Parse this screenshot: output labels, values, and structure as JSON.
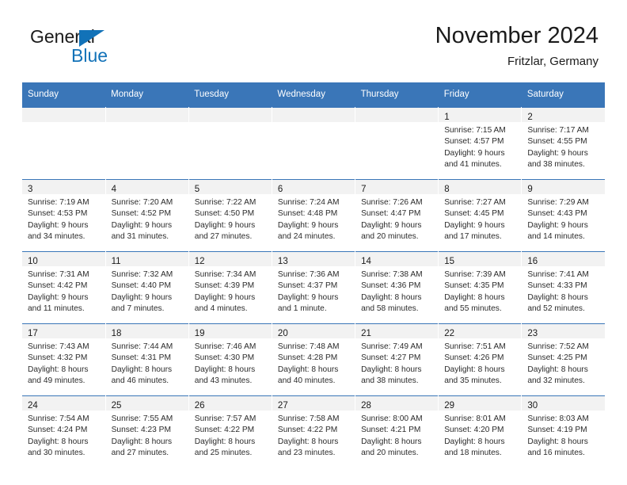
{
  "brand": {
    "name_part1": "General",
    "name_part2": "Blue",
    "triangle_icon": "triangle-icon",
    "colors": {
      "dark": "#1b1b1b",
      "blue": "#1272b8"
    }
  },
  "header": {
    "title": "November 2024",
    "subtitle": "Fritzlar, Germany"
  },
  "theme": {
    "header_blue": "#3a76b8",
    "daynum_band": "#f2f2f2",
    "cell_background": "#ffffff",
    "text": "#2b2b2b"
  },
  "weekday_headers": [
    "Sunday",
    "Monday",
    "Tuesday",
    "Wednesday",
    "Thursday",
    "Friday",
    "Saturday"
  ],
  "weeks": [
    [
      {
        "day": "",
        "sunrise": "",
        "sunset": "",
        "daylight_line1": "",
        "daylight_line2": ""
      },
      {
        "day": "",
        "sunrise": "",
        "sunset": "",
        "daylight_line1": "",
        "daylight_line2": ""
      },
      {
        "day": "",
        "sunrise": "",
        "sunset": "",
        "daylight_line1": "",
        "daylight_line2": ""
      },
      {
        "day": "",
        "sunrise": "",
        "sunset": "",
        "daylight_line1": "",
        "daylight_line2": ""
      },
      {
        "day": "",
        "sunrise": "",
        "sunset": "",
        "daylight_line1": "",
        "daylight_line2": ""
      },
      {
        "day": "1",
        "sunrise": "Sunrise: 7:15 AM",
        "sunset": "Sunset: 4:57 PM",
        "daylight_line1": "Daylight: 9 hours",
        "daylight_line2": "and 41 minutes."
      },
      {
        "day": "2",
        "sunrise": "Sunrise: 7:17 AM",
        "sunset": "Sunset: 4:55 PM",
        "daylight_line1": "Daylight: 9 hours",
        "daylight_line2": "and 38 minutes."
      }
    ],
    [
      {
        "day": "3",
        "sunrise": "Sunrise: 7:19 AM",
        "sunset": "Sunset: 4:53 PM",
        "daylight_line1": "Daylight: 9 hours",
        "daylight_line2": "and 34 minutes."
      },
      {
        "day": "4",
        "sunrise": "Sunrise: 7:20 AM",
        "sunset": "Sunset: 4:52 PM",
        "daylight_line1": "Daylight: 9 hours",
        "daylight_line2": "and 31 minutes."
      },
      {
        "day": "5",
        "sunrise": "Sunrise: 7:22 AM",
        "sunset": "Sunset: 4:50 PM",
        "daylight_line1": "Daylight: 9 hours",
        "daylight_line2": "and 27 minutes."
      },
      {
        "day": "6",
        "sunrise": "Sunrise: 7:24 AM",
        "sunset": "Sunset: 4:48 PM",
        "daylight_line1": "Daylight: 9 hours",
        "daylight_line2": "and 24 minutes."
      },
      {
        "day": "7",
        "sunrise": "Sunrise: 7:26 AM",
        "sunset": "Sunset: 4:47 PM",
        "daylight_line1": "Daylight: 9 hours",
        "daylight_line2": "and 20 minutes."
      },
      {
        "day": "8",
        "sunrise": "Sunrise: 7:27 AM",
        "sunset": "Sunset: 4:45 PM",
        "daylight_line1": "Daylight: 9 hours",
        "daylight_line2": "and 17 minutes."
      },
      {
        "day": "9",
        "sunrise": "Sunrise: 7:29 AM",
        "sunset": "Sunset: 4:43 PM",
        "daylight_line1": "Daylight: 9 hours",
        "daylight_line2": "and 14 minutes."
      }
    ],
    [
      {
        "day": "10",
        "sunrise": "Sunrise: 7:31 AM",
        "sunset": "Sunset: 4:42 PM",
        "daylight_line1": "Daylight: 9 hours",
        "daylight_line2": "and 11 minutes."
      },
      {
        "day": "11",
        "sunrise": "Sunrise: 7:32 AM",
        "sunset": "Sunset: 4:40 PM",
        "daylight_line1": "Daylight: 9 hours",
        "daylight_line2": "and 7 minutes."
      },
      {
        "day": "12",
        "sunrise": "Sunrise: 7:34 AM",
        "sunset": "Sunset: 4:39 PM",
        "daylight_line1": "Daylight: 9 hours",
        "daylight_line2": "and 4 minutes."
      },
      {
        "day": "13",
        "sunrise": "Sunrise: 7:36 AM",
        "sunset": "Sunset: 4:37 PM",
        "daylight_line1": "Daylight: 9 hours",
        "daylight_line2": "and 1 minute."
      },
      {
        "day": "14",
        "sunrise": "Sunrise: 7:38 AM",
        "sunset": "Sunset: 4:36 PM",
        "daylight_line1": "Daylight: 8 hours",
        "daylight_line2": "and 58 minutes."
      },
      {
        "day": "15",
        "sunrise": "Sunrise: 7:39 AM",
        "sunset": "Sunset: 4:35 PM",
        "daylight_line1": "Daylight: 8 hours",
        "daylight_line2": "and 55 minutes."
      },
      {
        "day": "16",
        "sunrise": "Sunrise: 7:41 AM",
        "sunset": "Sunset: 4:33 PM",
        "daylight_line1": "Daylight: 8 hours",
        "daylight_line2": "and 52 minutes."
      }
    ],
    [
      {
        "day": "17",
        "sunrise": "Sunrise: 7:43 AM",
        "sunset": "Sunset: 4:32 PM",
        "daylight_line1": "Daylight: 8 hours",
        "daylight_line2": "and 49 minutes."
      },
      {
        "day": "18",
        "sunrise": "Sunrise: 7:44 AM",
        "sunset": "Sunset: 4:31 PM",
        "daylight_line1": "Daylight: 8 hours",
        "daylight_line2": "and 46 minutes."
      },
      {
        "day": "19",
        "sunrise": "Sunrise: 7:46 AM",
        "sunset": "Sunset: 4:30 PM",
        "daylight_line1": "Daylight: 8 hours",
        "daylight_line2": "and 43 minutes."
      },
      {
        "day": "20",
        "sunrise": "Sunrise: 7:48 AM",
        "sunset": "Sunset: 4:28 PM",
        "daylight_line1": "Daylight: 8 hours",
        "daylight_line2": "and 40 minutes."
      },
      {
        "day": "21",
        "sunrise": "Sunrise: 7:49 AM",
        "sunset": "Sunset: 4:27 PM",
        "daylight_line1": "Daylight: 8 hours",
        "daylight_line2": "and 38 minutes."
      },
      {
        "day": "22",
        "sunrise": "Sunrise: 7:51 AM",
        "sunset": "Sunset: 4:26 PM",
        "daylight_line1": "Daylight: 8 hours",
        "daylight_line2": "and 35 minutes."
      },
      {
        "day": "23",
        "sunrise": "Sunrise: 7:52 AM",
        "sunset": "Sunset: 4:25 PM",
        "daylight_line1": "Daylight: 8 hours",
        "daylight_line2": "and 32 minutes."
      }
    ],
    [
      {
        "day": "24",
        "sunrise": "Sunrise: 7:54 AM",
        "sunset": "Sunset: 4:24 PM",
        "daylight_line1": "Daylight: 8 hours",
        "daylight_line2": "and 30 minutes."
      },
      {
        "day": "25",
        "sunrise": "Sunrise: 7:55 AM",
        "sunset": "Sunset: 4:23 PM",
        "daylight_line1": "Daylight: 8 hours",
        "daylight_line2": "and 27 minutes."
      },
      {
        "day": "26",
        "sunrise": "Sunrise: 7:57 AM",
        "sunset": "Sunset: 4:22 PM",
        "daylight_line1": "Daylight: 8 hours",
        "daylight_line2": "and 25 minutes."
      },
      {
        "day": "27",
        "sunrise": "Sunrise: 7:58 AM",
        "sunset": "Sunset: 4:22 PM",
        "daylight_line1": "Daylight: 8 hours",
        "daylight_line2": "and 23 minutes."
      },
      {
        "day": "28",
        "sunrise": "Sunrise: 8:00 AM",
        "sunset": "Sunset: 4:21 PM",
        "daylight_line1": "Daylight: 8 hours",
        "daylight_line2": "and 20 minutes."
      },
      {
        "day": "29",
        "sunrise": "Sunrise: 8:01 AM",
        "sunset": "Sunset: 4:20 PM",
        "daylight_line1": "Daylight: 8 hours",
        "daylight_line2": "and 18 minutes."
      },
      {
        "day": "30",
        "sunrise": "Sunrise: 8:03 AM",
        "sunset": "Sunset: 4:19 PM",
        "daylight_line1": "Daylight: 8 hours",
        "daylight_line2": "and 16 minutes."
      }
    ]
  ]
}
